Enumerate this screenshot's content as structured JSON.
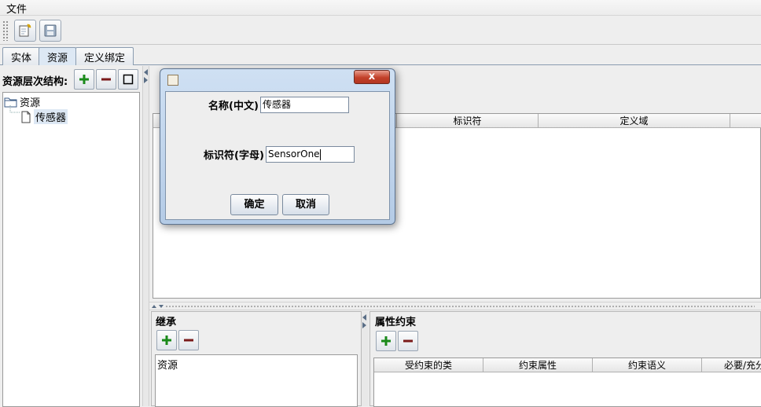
{
  "menu": {
    "file": "文件"
  },
  "toolbar": {
    "new_icon": "new-document-icon",
    "save_icon": "save-icon"
  },
  "tabs": [
    {
      "label": "实体",
      "selected": false
    },
    {
      "label": "资源",
      "selected": true
    },
    {
      "label": "定义绑定",
      "selected": false
    }
  ],
  "left": {
    "title": "资源层次结构:",
    "tree": {
      "root": "资源",
      "child": "传感器"
    }
  },
  "top_table": {
    "columns": [
      "标识符",
      "定义域"
    ]
  },
  "inherit": {
    "title": "继承",
    "items": [
      "资源"
    ]
  },
  "props": {
    "title": "属性约束",
    "columns": [
      "受约束的类",
      "约束属性",
      "约束语义",
      "必要/充分"
    ]
  },
  "dialog": {
    "name_label": "名称(中文)",
    "name_value": "传感器",
    "id_label": "标识符(字母)",
    "id_value": "SensorOne",
    "ok": "确定",
    "cancel": "取消",
    "close": "x"
  },
  "colors": {
    "accent": "#dde8f4",
    "close": "#c2412a",
    "add": "#1a8a1a",
    "remove": "#7a1a1a"
  }
}
